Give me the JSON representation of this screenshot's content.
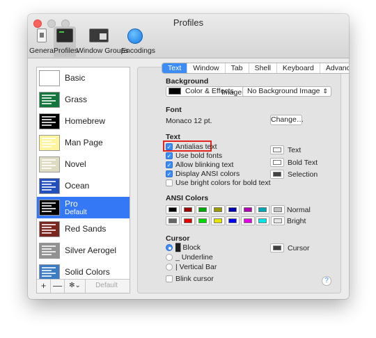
{
  "window": {
    "title": "Profiles"
  },
  "toolbar": {
    "items": [
      {
        "label": "General",
        "icon": "general-icon"
      },
      {
        "label": "Profiles",
        "icon": "terminal-icon",
        "selected": true
      },
      {
        "label": "Window Groups",
        "icon": "window-groups-icon"
      },
      {
        "label": "Encodings",
        "icon": "globe-icon"
      }
    ]
  },
  "profiles": [
    {
      "name": "Basic",
      "thumb_bg": "#ffffff"
    },
    {
      "name": "Grass",
      "thumb_bg": "#13773d"
    },
    {
      "name": "Homebrew",
      "thumb_bg": "#000000"
    },
    {
      "name": "Man Page",
      "thumb_bg": "#fef49c"
    },
    {
      "name": "Novel",
      "thumb_bg": "#dfdbc3"
    },
    {
      "name": "Ocean",
      "thumb_bg": "#224fbc"
    },
    {
      "name": "Pro",
      "sub": "Default",
      "thumb_bg": "#000000",
      "selected": true
    },
    {
      "name": "Red Sands",
      "thumb_bg": "#7a251e"
    },
    {
      "name": "Silver Aerogel",
      "thumb_bg": "#929292"
    },
    {
      "name": "Solid Colors",
      "thumb_bg": "#3b7dc4"
    }
  ],
  "sidebar_footer": {
    "add": "+",
    "remove": "—",
    "actions": "✻⌄",
    "default": "Default"
  },
  "tabs": [
    {
      "label": "Text",
      "selected": true
    },
    {
      "label": "Window"
    },
    {
      "label": "Tab"
    },
    {
      "label": "Shell"
    },
    {
      "label": "Keyboard"
    },
    {
      "label": "Advanced"
    }
  ],
  "background": {
    "heading": "Background",
    "color_button": "Color & Effects",
    "image_label": "Image:",
    "image_value": "No Background Image",
    "swatch_color": "#000000"
  },
  "font": {
    "heading": "Font",
    "value": "Monaco 12 pt.",
    "change_button": "Change…"
  },
  "text": {
    "heading": "Text",
    "options": [
      {
        "label": "Antialias text",
        "checked": true
      },
      {
        "label": "Use bold fonts",
        "checked": true
      },
      {
        "label": "Allow blinking text",
        "checked": true
      },
      {
        "label": "Display ANSI colors",
        "checked": true
      },
      {
        "label": "Use bright colors for bold text",
        "checked": false
      }
    ],
    "colors": [
      {
        "label": "Text",
        "color": "#f2f2f2"
      },
      {
        "label": "Bold Text",
        "color": "#ffffff"
      },
      {
        "label": "Selection",
        "color": "#414141"
      }
    ]
  },
  "ansi": {
    "heading": "ANSI Colors",
    "normal_label": "Normal",
    "bright_label": "Bright",
    "normal": [
      "#000000",
      "#990000",
      "#00a600",
      "#999900",
      "#0000b2",
      "#b200b2",
      "#00a6b2",
      "#bfbfbf"
    ],
    "bright": [
      "#666666",
      "#e50000",
      "#00d900",
      "#e5e500",
      "#0000ff",
      "#e500e5",
      "#00e5e5",
      "#e5e5e5"
    ]
  },
  "cursor": {
    "heading": "Cursor",
    "options": [
      {
        "label": "█ Block",
        "selected": true
      },
      {
        "label": "_ Underline",
        "selected": false
      },
      {
        "label": "| Vertical Bar",
        "selected": false
      }
    ],
    "blink_label": "Blink cursor",
    "blink_checked": false,
    "color_label": "Cursor",
    "color": "#414141"
  },
  "help": "?",
  "highlight_color": "#e2241f"
}
